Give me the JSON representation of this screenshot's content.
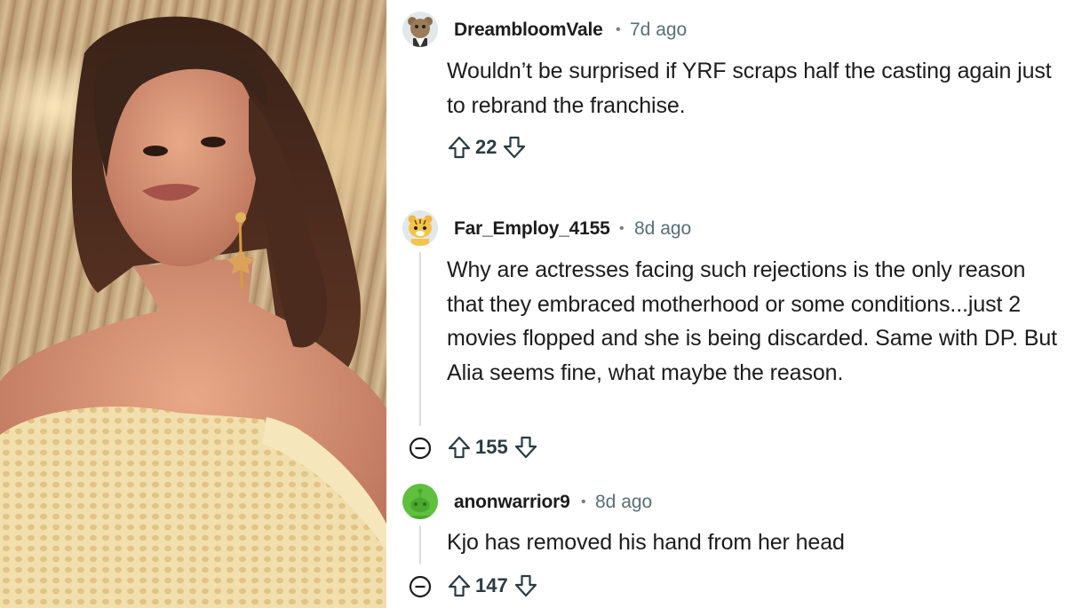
{
  "colors": {
    "text": "#1c1c1c",
    "meta": "#576f76",
    "thread_line": "#d9dde0",
    "icon": "#2a3c42"
  },
  "comments": [
    {
      "username": "DreambloomVale",
      "separator": "•",
      "time": "7d ago",
      "body": "Wouldn’t be surprised if YRF scraps half the casting again just to rebrand the franchise.",
      "votes": "22",
      "avatar_icon": "bear-avatar-icon"
    },
    {
      "username": "Far_Employ_4155",
      "separator": "•",
      "time": "8d ago",
      "body": "Why are actresses facing such rejections is the only reason that they embraced motherhood or some conditions...just 2 movies flopped and she is being discarded. Same with DP. But Alia seems fine, what maybe the reason.",
      "votes": "155",
      "avatar_icon": "tiger-avatar-icon"
    },
    {
      "username": "anonwarrior9",
      "separator": "•",
      "time": "8d ago",
      "body": "Kjo has removed his hand from her head",
      "votes": "147",
      "avatar_icon": "snoo-avatar-icon"
    }
  ]
}
